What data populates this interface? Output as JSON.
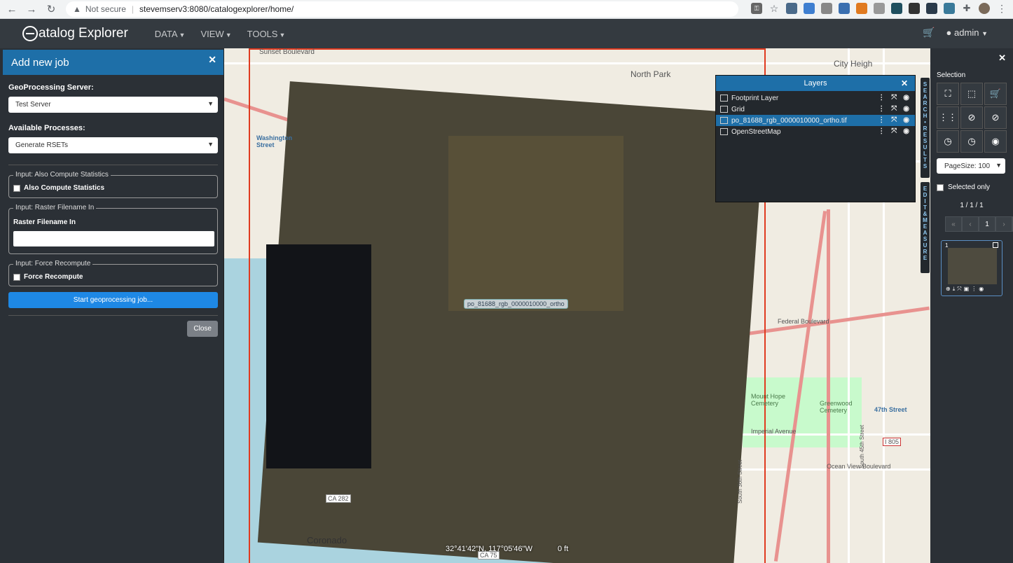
{
  "browser": {
    "security": "Not secure",
    "url": "stevemserv3:8080/catalogexplorer/home/"
  },
  "app": {
    "brand": "atalog Explorer",
    "menu": [
      {
        "label": "DATA"
      },
      {
        "label": "VIEW"
      },
      {
        "label": "TOOLS"
      }
    ],
    "user": "admin"
  },
  "job_panel": {
    "title": "Add new job",
    "server_label": "GeoProcessing Server:",
    "server_value": "Test Server",
    "process_label": "Available Processes:",
    "process_value": "Generate RSETs",
    "fs_stats_legend": "Input: Also Compute Statistics",
    "fs_stats_label": "Also Compute Statistics",
    "fs_raster_legend": "Input: Raster Filename In",
    "fs_raster_label": "Raster Filename In",
    "fs_raster_value": "",
    "fs_force_legend": "Input: Force Recompute",
    "fs_force_label": "Force Recompute",
    "start_button": "Start geoprocessing job...",
    "close_button": "Close"
  },
  "layers_panel": {
    "title": "Layers",
    "layers": [
      {
        "name": "Footprint Layer",
        "active": false
      },
      {
        "name": "Grid",
        "active": false
      },
      {
        "name": "po_81688_rgb_0000010000_ortho.tif",
        "active": true
      },
      {
        "name": "OpenStreetMap",
        "active": false
      }
    ]
  },
  "side_tabs": {
    "search_results": "SEARCH•RESULTS",
    "edit_measure": "EDIT&MEASURE"
  },
  "selection_panel": {
    "label": "Selection",
    "page_size": "PageSize: 100",
    "selected_only": "Selected only",
    "page_count": "1 / 1 / 1",
    "current_page": "1",
    "thumb_index": "1"
  },
  "map": {
    "coordinate": "32°41'42\"N, 117°05'46\"W",
    "scale": "0 ft",
    "raster_tag": "po_81688_rgb_0000010000_ortho",
    "labels": {
      "sunset": "Sunset Boulevard",
      "north_park": "North Park",
      "city_heights": "City Heigh",
      "washington": "Washington Street",
      "coronado": "Coronado",
      "federal": "Federal Boulevard",
      "imperial": "Imperial Avenue",
      "ocean_view": "Ocean View Boulevard",
      "mount_hope": "Mount Hope Cemetery",
      "greenwood": "Greenwood Cemetery",
      "street_47": "47th Street",
      "i805": "I 805",
      "ca282": "CA 282",
      "ca75": "CA 75",
      "st_45": "South 45th Street",
      "st_36": "South 36th Street"
    }
  }
}
